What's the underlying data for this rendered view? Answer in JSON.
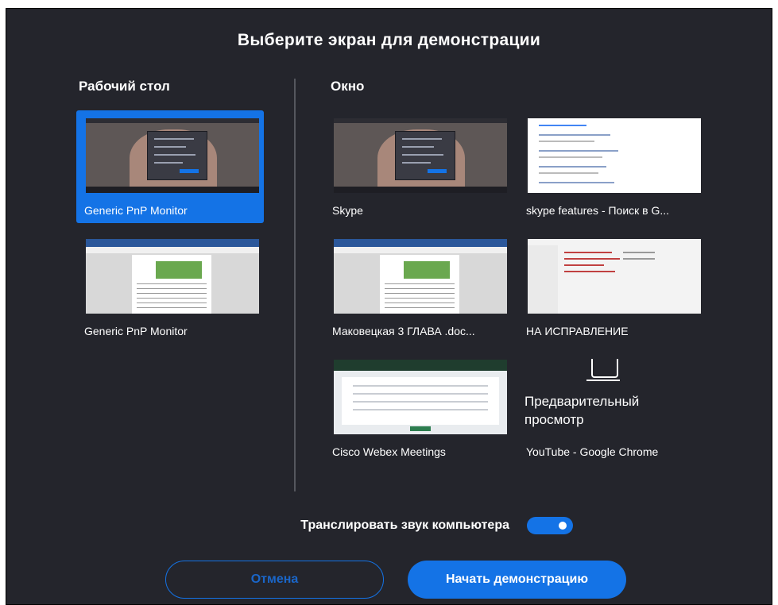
{
  "dialog": {
    "title": "Выберите экран для демонстрации"
  },
  "desktop_section": {
    "label": "Рабочий стол",
    "items": [
      {
        "label": "Generic PnP Monitor",
        "selected": true,
        "thumbnail": "skype-call"
      },
      {
        "label": "Generic PnP Monitor",
        "selected": false,
        "thumbnail": "word-document"
      }
    ]
  },
  "window_section": {
    "label": "Окно",
    "items": [
      {
        "label": "Skype",
        "thumbnail": "skype-call"
      },
      {
        "label": "skype features - Поиск в G...",
        "thumbnail": "web-search-results"
      },
      {
        "label": "Маковецкая 3 ГЛАВА .doc...",
        "thumbnail": "word-document"
      },
      {
        "label": "НА ИСПРАВЛЕНИЕ",
        "thumbnail": "file-explorer"
      },
      {
        "label": "Cisco Webex Meetings",
        "thumbnail": "webex-page"
      },
      {
        "label": "YouTube - Google Chrome",
        "thumbnail": "preview-placeholder",
        "preview_text": "Предварительный просмотр"
      }
    ]
  },
  "audio": {
    "label": "Транслировать звук компьютера",
    "enabled": true
  },
  "buttons": {
    "cancel": "Отмена",
    "start": "Начать демонстрацию"
  },
  "colors": {
    "accent": "#1473e6",
    "background": "#24252c",
    "text": "#ffffff"
  }
}
